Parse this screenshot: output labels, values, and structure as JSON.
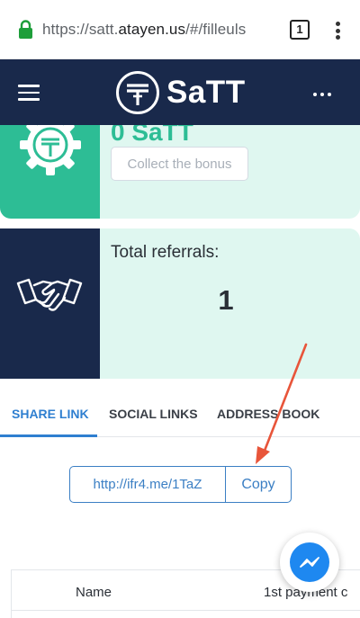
{
  "browser": {
    "url_prefix": "https://satt.",
    "url_host": "atayen.us",
    "url_suffix": "/#/filleuls",
    "tab_count": "1"
  },
  "header": {
    "brand": "SaTT"
  },
  "bonus": {
    "amount": "0 SaTT",
    "collect_label": "Collect the bonus"
  },
  "referrals": {
    "label": "Total referrals:",
    "count": "1"
  },
  "tabs": [
    {
      "label": "SHARE LINK",
      "active": true
    },
    {
      "label": "SOCIAL LINKS",
      "active": false
    },
    {
      "label": "ADDRESS BOOK",
      "active": false
    }
  ],
  "share": {
    "link": "http://ifr4.me/1TaZ",
    "copy_label": "Copy"
  },
  "table": {
    "columns": [
      "Name",
      "1st payment c"
    ]
  },
  "colors": {
    "navy": "#19294b",
    "green": "#2dbd95",
    "mint": "#dff7f0",
    "accent": "#2f7fd0",
    "arrow": "#e8553a"
  }
}
